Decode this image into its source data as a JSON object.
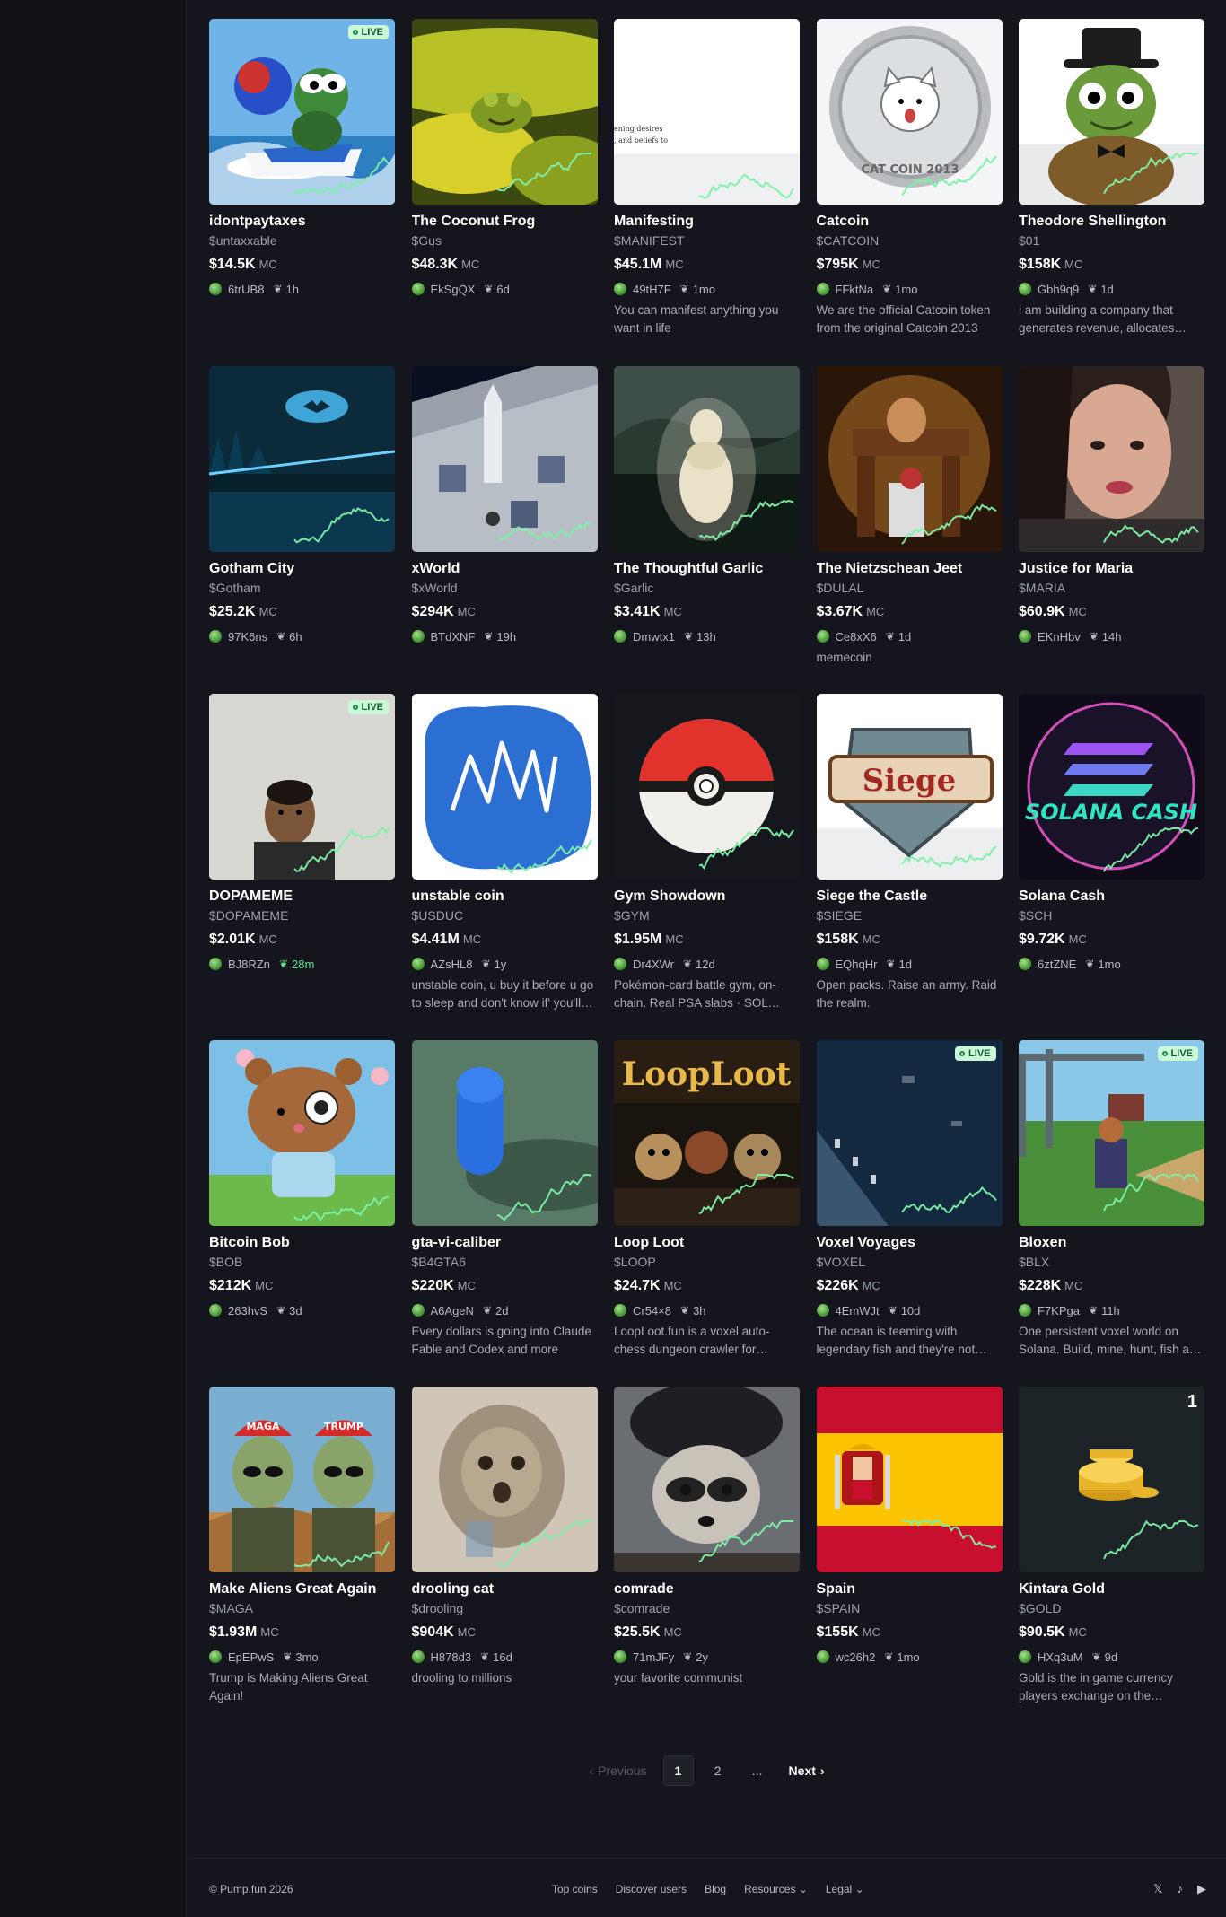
{
  "cards": [
    {
      "name": "idontpaytaxes",
      "ticker": "$untaxxable",
      "mc": "$14.5K",
      "creator": "6trUB8",
      "age": "1h",
      "desc": "",
      "live": true,
      "art": "pepe"
    },
    {
      "name": "The Coconut Frog",
      "ticker": "$Gus",
      "mc": "$48.3K",
      "creator": "EkSgQX",
      "age": "6d",
      "desc": "",
      "art": "coconut"
    },
    {
      "name": "Manifesting",
      "ticker": "$MANIFEST",
      "mc": "$45.1M",
      "creator": "49tH7F",
      "age": "1mo",
      "desc": "You can manifest anything you want in life",
      "art": "manifest"
    },
    {
      "name": "Catcoin",
      "ticker": "$CATCOIN",
      "mc": "$795K",
      "creator": "FFktNa",
      "age": "1mo",
      "desc": "We are the official Catcoin token from the original Catcoin 2013",
      "art": "catcoin"
    },
    {
      "name": "Theodore Shellington",
      "ticker": "$01",
      "mc": "$158K",
      "creator": "Gbh9q9",
      "age": "1d",
      "desc": "i am building a company that generates revenue, allocates profit",
      "art": "turtle"
    },
    {
      "name": "Gotham City",
      "ticker": "$Gotham",
      "mc": "$25.2K",
      "creator": "97K6ns",
      "age": "6h",
      "desc": "",
      "art": "gotham"
    },
    {
      "name": "xWorld",
      "ticker": "$xWorld",
      "mc": "$294K",
      "creator": "BTdXNF",
      "age": "19h",
      "desc": "",
      "art": "xworld"
    },
    {
      "name": "The Thoughtful Garlic",
      "ticker": "$Garlic",
      "mc": "$3.41K",
      "creator": "Dmwtx1",
      "age": "13h",
      "desc": "",
      "art": "garlic"
    },
    {
      "name": "The Nietzschean Jeet",
      "ticker": "$DULAL",
      "mc": "$3.67K",
      "creator": "Ce8xX6",
      "age": "1d",
      "desc": "memecoin",
      "art": "jeet"
    },
    {
      "name": "Justice for Maria",
      "ticker": "$MARIA",
      "mc": "$60.9K",
      "creator": "EKnHbv",
      "age": "14h",
      "desc": "",
      "art": "maria"
    },
    {
      "name": "DOPAMEME",
      "ticker": "$DOPAMEME",
      "mc": "$2.01K",
      "creator": "BJ8RZn",
      "age": "28m",
      "desc": "",
      "live": true,
      "fresh": true,
      "art": "dopameme"
    },
    {
      "name": "unstable coin",
      "ticker": "$USDUC",
      "mc": "$4.41M",
      "creator": "AZsHL8",
      "age": "1y",
      "desc": "unstable coin, u buy it before u go to sleep and don't know if' you'll wake up",
      "art": "unstable"
    },
    {
      "name": "Gym Showdown",
      "ticker": "$GYM",
      "mc": "$1.95M",
      "creator": "Dr4XWr",
      "age": "12d",
      "desc": "Pokémon-card battle gym, on-chain. Real PSA slabs · SOL rewards",
      "art": "pokeball"
    },
    {
      "name": "Siege the Castle",
      "ticker": "$SIEGE",
      "mc": "$158K",
      "creator": "EQhqHr",
      "age": "1d",
      "desc": "Open packs. Raise an army. Raid the realm.",
      "art": "siege"
    },
    {
      "name": "Solana Cash",
      "ticker": "$SCH",
      "mc": "$9.72K",
      "creator": "6ztZNE",
      "age": "1mo",
      "desc": "",
      "art": "solcash"
    },
    {
      "name": "Bitcoin Bob",
      "ticker": "$BOB",
      "mc": "$212K",
      "creator": "263hvS",
      "age": "3d",
      "desc": "",
      "art": "bob"
    },
    {
      "name": "gta-vi-caliber",
      "ticker": "$B4GTA6",
      "mc": "$220K",
      "creator": "A6AgeN",
      "age": "2d",
      "desc": "Every dollars is going into Claude Fable and Codex and more",
      "art": "gta"
    },
    {
      "name": "Loop Loot",
      "ticker": "$LOOP",
      "mc": "$24.7K",
      "creator": "Cr54×8",
      "age": "3h",
      "desc": "LoopLoot.fun is a voxel auto-chess dungeon crawler for everyone",
      "art": "looploot"
    },
    {
      "name": "Voxel Voyages",
      "ticker": "$VOXEL",
      "mc": "$226K",
      "creator": "4EmWJt",
      "age": "10d",
      "desc": "The ocean is teeming with legendary fish and they're not going to catch themselves",
      "live": true,
      "art": "voxel"
    },
    {
      "name": "Bloxen",
      "ticker": "$BLX",
      "mc": "$228K",
      "creator": "F7KPga",
      "age": "11h",
      "desc": "One persistent voxel world on Solana. Build, mine, hunt, fish and trade",
      "live": true,
      "art": "bloxen"
    },
    {
      "name": "Make Aliens Great Again",
      "ticker": "$MAGA",
      "mc": "$1.93M",
      "creator": "EpEPwS",
      "age": "3mo",
      "desc": "Trump is Making Aliens Great Again!",
      "art": "aliens",
      "cap1": "MAGA",
      "cap2": "TRUMP"
    },
    {
      "name": "drooling cat",
      "ticker": "$drooling",
      "mc": "$904K",
      "creator": "H878d3",
      "age": "16d",
      "desc": "drooling to millions",
      "art": "droolcat"
    },
    {
      "name": "comrade",
      "ticker": "$comrade",
      "mc": "$25.5K",
      "creator": "71mJFy",
      "age": "2y",
      "desc": "your favorite communist",
      "art": "raccoon"
    },
    {
      "name": "Spain",
      "ticker": "$SPAIN",
      "mc": "$155K",
      "creator": "wc26h2",
      "age": "1mo",
      "desc": "",
      "art": "spain"
    },
    {
      "name": "Kintara Gold",
      "ticker": "$GOLD",
      "mc": "$90.5K",
      "creator": "HXq3uM",
      "age": "9d",
      "desc": "Gold is the in game currency players exchange on the marketplace",
      "art": "gold",
      "rank": "1"
    }
  ],
  "card_labels": {
    "mc_label": "MC",
    "live_label": "LIVE"
  },
  "art_text": {
    "catcoin": "CAT COIN 2013",
    "siege": "Siege",
    "solana_cash": "SOLANA CASH",
    "loop_loot": "LoopLoot",
    "manifest_1": "ening desires",
    "manifest_2": ", and beliefs to"
  },
  "pagination": {
    "previous": "Previous",
    "pages": [
      "1",
      "2"
    ],
    "current": "1",
    "ellipsis": "...",
    "next": "Next"
  },
  "footer": {
    "copyright": "© Pump.fun 2026",
    "links": [
      "Top coins",
      "Discover users",
      "Blog",
      "Resources",
      "Legal"
    ],
    "social": [
      "x-icon",
      "tiktok-icon",
      "youtube-icon"
    ]
  },
  "colors": {
    "accent": "#5ce08a",
    "background": "#15161d",
    "live_border": "#7dd6a0"
  }
}
